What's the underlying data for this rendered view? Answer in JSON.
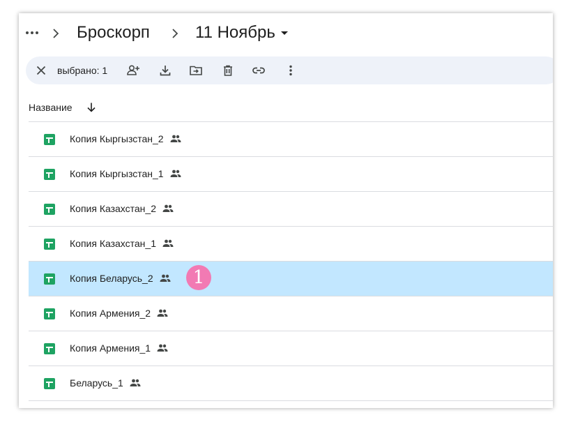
{
  "breadcrumb": {
    "more_icon": "more-horiz-icon",
    "items": [
      {
        "label": "Броскорп"
      }
    ],
    "current": {
      "label": "11 Ноябрь",
      "icon": "dropdown-caret-icon"
    }
  },
  "selection_bar": {
    "count_label": "выбрано: 1",
    "actions": [
      {
        "name": "clear-selection",
        "icon": "close-icon"
      },
      {
        "name": "share",
        "icon": "person-add-icon"
      },
      {
        "name": "download",
        "icon": "download-icon"
      },
      {
        "name": "move",
        "icon": "move-to-folder-icon"
      },
      {
        "name": "delete",
        "icon": "trash-icon"
      },
      {
        "name": "copy-link",
        "icon": "link-icon"
      },
      {
        "name": "more-actions",
        "icon": "more-vert-icon"
      }
    ]
  },
  "list_header": {
    "column_name": "Название",
    "sort_icon": "arrow-down-icon"
  },
  "files": [
    {
      "name": "Копия Кыргызстан_2",
      "shared": true,
      "selected": false
    },
    {
      "name": "Копия Кыргызстан_1",
      "shared": true,
      "selected": false
    },
    {
      "name": "Копия Казахстан_2",
      "shared": true,
      "selected": false
    },
    {
      "name": "Копия Казахстан_1",
      "shared": true,
      "selected": false
    },
    {
      "name": "Копия Беларусь_2",
      "shared": true,
      "selected": true
    },
    {
      "name": "Копия Армения_2",
      "shared": true,
      "selected": false
    },
    {
      "name": "Копия Армения_1",
      "shared": true,
      "selected": false
    },
    {
      "name": "Беларусь_1",
      "shared": true,
      "selected": false
    }
  ],
  "annotation": {
    "marker_label": "1"
  },
  "colors": {
    "selected_row": "#c2e7ff",
    "selection_bar": "#eef2f9",
    "sheets_green": "#1ea362",
    "marker_pink": "#f27ab3",
    "divider": "#dadce0"
  }
}
